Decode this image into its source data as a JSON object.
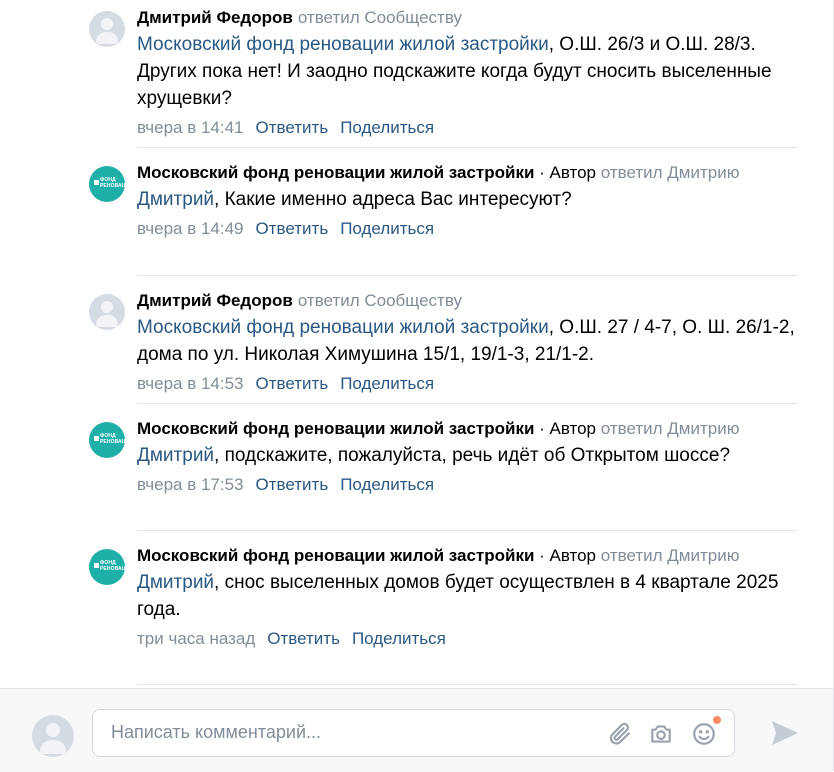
{
  "comments": [
    {
      "author": "Дмитрий Федоров",
      "author_suffix": "",
      "replied": "ответил Сообществу",
      "mention": "Московский фонд реновации жилой застройки",
      "text": ", О.Ш. 26/3 и О.Ш. 28/3. Других пока нет! И заодно подскажите когда будут сносить выселенные хрущевки?",
      "time": "вчера в 14:41",
      "avatar": "user"
    },
    {
      "author": "Московский фонд реновации жилой застройки",
      "author_suffix": " · Автор",
      "replied": "ответил Дмитрию",
      "mention": "Дмитрий",
      "text": ", Какие именно адреса Вас интересуют?",
      "time": "вчера в 14:49",
      "avatar": "fund"
    },
    {
      "author": "Дмитрий Федоров",
      "author_suffix": "",
      "replied": "ответил Сообществу",
      "mention": "Московский фонд реновации жилой застройки",
      "text": ", О.Ш. 27 / 4-7, О. Ш. 26/1-2, дома по ул. Николая Химушина 15/1, 19/1-3, 21/1-2.",
      "time": "вчера в 14:53",
      "avatar": "user"
    },
    {
      "author": "Московский фонд реновации жилой застройки",
      "author_suffix": " · Автор",
      "replied": "ответил Дмитрию",
      "mention": "Дмитрий",
      "text": ", подскажите, пожалуйста, речь идёт об Открытом шоссе?",
      "time": "вчера в 17:53",
      "avatar": "fund"
    },
    {
      "author": "Московский фонд реновации жилой застройки",
      "author_suffix": " · Автор",
      "replied": "ответил Дмитрию",
      "mention": "Дмитрий",
      "text": ", снос выселенных домов будет осуществлен в 4 квартале 2025 года.",
      "time": "три часа назад",
      "avatar": "fund"
    }
  ],
  "actions": {
    "reply": "Ответить",
    "share": "Поделиться"
  },
  "fund_logo_text": "фонд\nреновации",
  "composer": {
    "placeholder": "Написать комментарий...",
    "icons": [
      "paperclip-icon",
      "camera-icon",
      "emoji-icon",
      "send-icon"
    ]
  },
  "colors": {
    "link": "#2a5885",
    "muted": "#818c99",
    "fund_avatar": "#1dafa8"
  }
}
